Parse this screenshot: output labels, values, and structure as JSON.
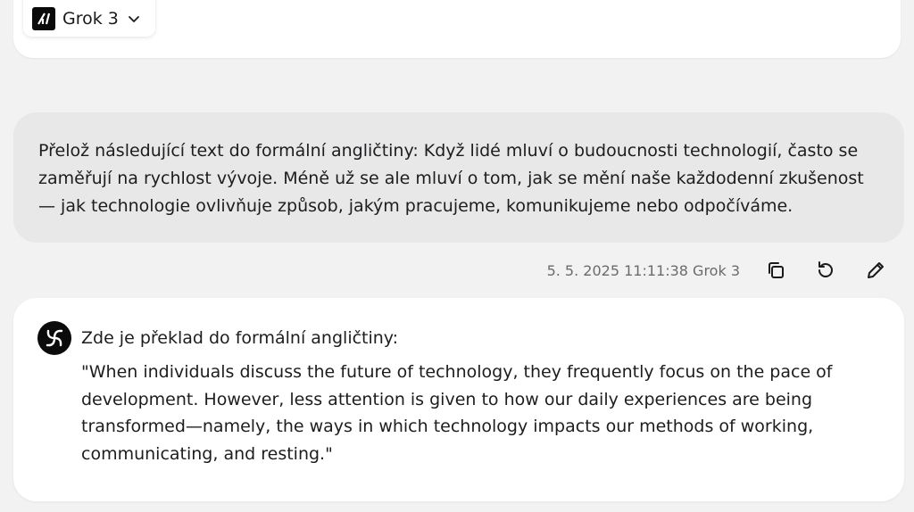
{
  "header": {
    "model_label": "Grok 3",
    "logo_icon": "grok-logo-icon",
    "dropdown_icon": "chevron-down-icon"
  },
  "user_message": {
    "text": "Přelož následující text do formální angličtiny: Když lidé mluví o budoucnosti technologií, často se zaměřují na rychlost vývoje. Méně už se ale mluví o tom, jak se mění naše každodenní zkušenost — jak technologie ovlivňuje způsob, jakým pracujeme, komunikujeme nebo odpočíváme."
  },
  "message_meta": {
    "timestamp": "5. 5. 2025 11:11:38",
    "model": "Grok 3",
    "actions": [
      "copy-icon",
      "regenerate-icon",
      "edit-icon"
    ]
  },
  "assistant_message": {
    "intro": "Zde je překlad do formální angličtiny:",
    "quote": "\"When individuals discuss the future of technology, they frequently focus on the pace of development. However, less attention is given to how our daily experiences are being transformed—namely, the ways in which technology impacts our methods of working, communicating, and resting.\""
  },
  "colors": {
    "page_bg": "#f2f2f2",
    "user_bubble_bg": "#e8e8e9",
    "card_bg": "#ffffff",
    "text": "#1d1d1f",
    "meta_text": "#6b6b6b"
  }
}
